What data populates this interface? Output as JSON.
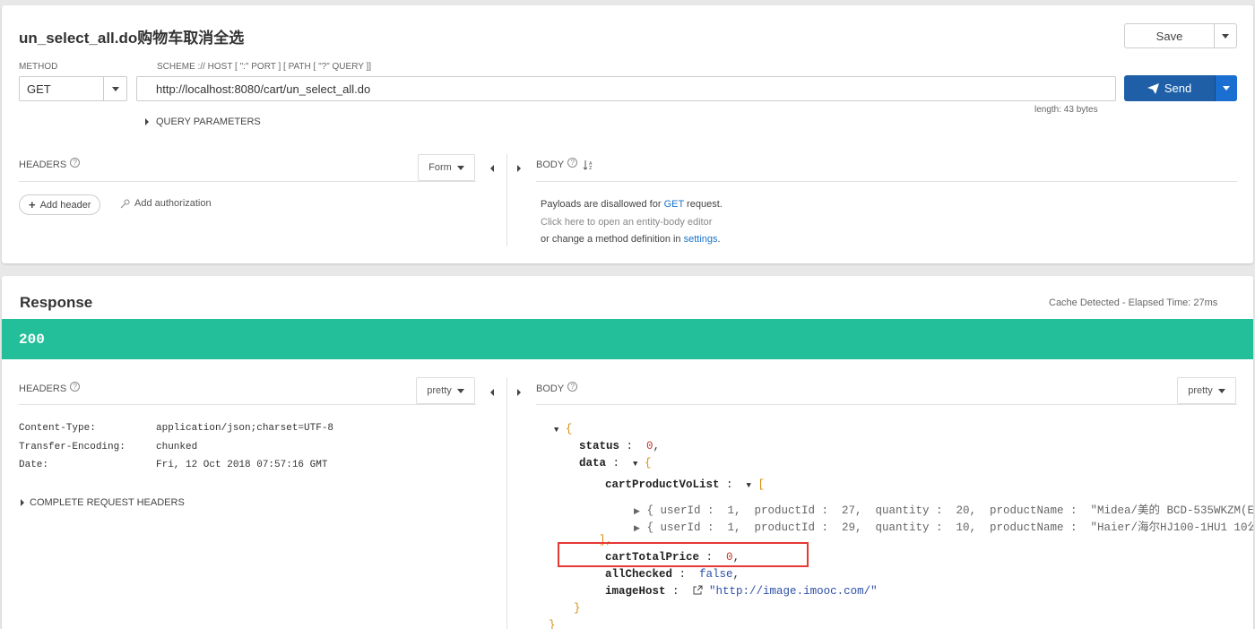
{
  "request": {
    "title": "un_select_all.do购物车取消全选",
    "save_label": "Save",
    "method_label": "METHOD",
    "method_value": "GET",
    "url_label": "SCHEME :// HOST [ \":\" PORT ] [ PATH [ \"?\" QUERY ]]",
    "url_value": "http://localhost:8080/cart/un_select_all.do",
    "send_label": "Send",
    "length_text": "length: 43 bytes",
    "query_params_label": "QUERY PARAMETERS",
    "headers_label": "HEADERS",
    "form_label": "Form",
    "body_label": "BODY",
    "add_header_label": "Add header",
    "add_auth_label": "Add authorization",
    "payload_line1_prefix": "Payloads are disallowed for ",
    "payload_line1_link": "GET",
    "payload_line1_suffix": " request.",
    "payload_line2": "Click here to open an entity-body editor",
    "payload_line3_prefix": "or change a method definition in ",
    "payload_line3_link": "settings",
    "payload_line3_suffix": "."
  },
  "response": {
    "title": "Response",
    "elapsed": "Cache Detected - Elapsed Time: 27ms",
    "status_code": "200",
    "headers_label": "HEADERS",
    "pretty_label": "pretty",
    "body_label": "BODY",
    "headers": [
      {
        "name": "Content-Type:",
        "value": "application/json;charset=UTF-8"
      },
      {
        "name": "Transfer-Encoding:",
        "value": "chunked"
      },
      {
        "name": "Date:",
        "value": "Fri, 12 Oct 2018 07:57:16 GMT"
      }
    ],
    "complete_headers_label": "COMPLETE REQUEST HEADERS",
    "json": {
      "status_key": "status",
      "status_val": "0",
      "data_key": "data",
      "list_key": "cartProductVoList",
      "items": [
        "{ userId :  1,  productId :  27,  quantity :  20,  productName :  \"Midea/美的 BCD-535WKZM(E)",
        "{ userId :  1,  productId :  29,  quantity :  10,  productName :  \"Haier/海尔HJ100-1HU1 10公"
      ],
      "total_key": "cartTotalPrice",
      "total_val": "0",
      "checked_key": "allChecked",
      "checked_val": "false",
      "host_key": "imageHost",
      "host_val": "\"http://image.imooc.com/\""
    },
    "highlight_color": "#e53935"
  }
}
